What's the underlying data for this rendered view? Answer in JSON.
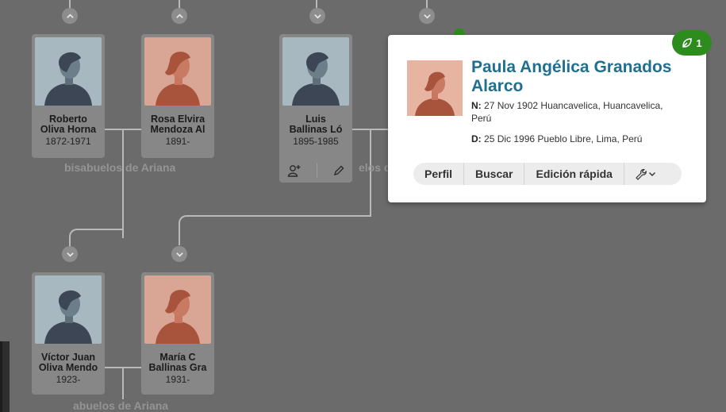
{
  "tree": {
    "generation_labels": {
      "great_grandparents": "bisabuelos de Ariana",
      "grandparents_partial": "elos de",
      "grandparents": "abuelos de Ariana"
    },
    "people": [
      {
        "id": "roberto",
        "name": "Roberto\nOliva Horna",
        "years": "1872-1971",
        "gender": "male"
      },
      {
        "id": "rosa",
        "name": "Rosa Elvira\nMendoza Al",
        "years": "1891-",
        "gender": "female"
      },
      {
        "id": "luis",
        "name": "Luis\nBallinas Ló",
        "years": "1895-1985",
        "gender": "male"
      },
      {
        "id": "victor",
        "name": "Víctor Juan\nOliva Mendo",
        "years": "1923-",
        "gender": "male"
      },
      {
        "id": "maria",
        "name": "María C\nBallinas Gra",
        "years": "1931-",
        "gender": "female"
      }
    ]
  },
  "popup": {
    "name": "Paula Angélica Granados Alarco",
    "birth_label": "N:",
    "birth_value": "27 Nov 1902 Huancavelica, Huancavelica, Perú",
    "death_label": "D:",
    "death_value": "25 Dic 1996 Pueblo Libre, Lima, Perú",
    "buttons": {
      "profile": "Perfil",
      "search": "Buscar",
      "quick_edit": "Edición rápida"
    },
    "tools_icon": "wrench-icon"
  },
  "hints": {
    "count": "1",
    "icon": "leaf-icon"
  },
  "colors": {
    "link": "#1f6f90",
    "hint_green": "#2e8b1e",
    "male_bg": "#a7b8c0",
    "female_bg": "#d9a595"
  }
}
